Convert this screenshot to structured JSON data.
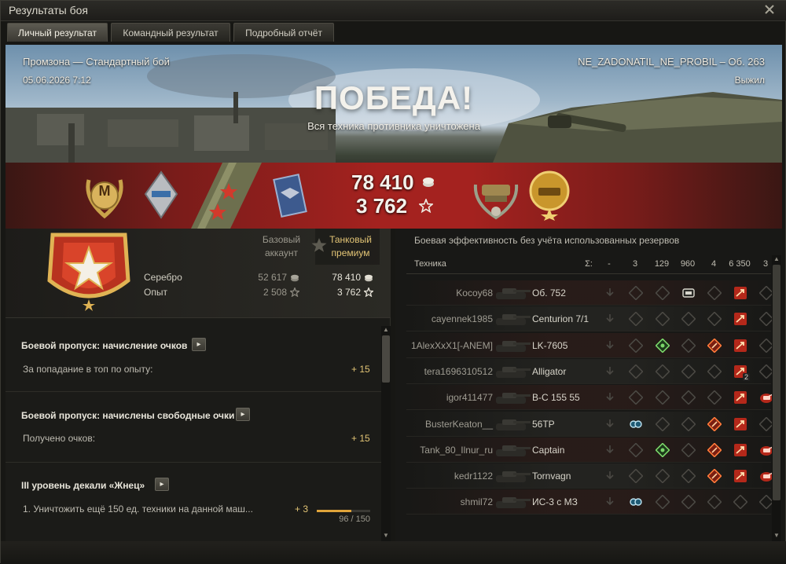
{
  "window": {
    "title": "Результаты боя"
  },
  "tabs": [
    {
      "label": "Личный результат",
      "active": true
    },
    {
      "label": "Командный результат",
      "active": false
    },
    {
      "label": "Подробный отчёт",
      "active": false
    }
  ],
  "battle": {
    "map_mode": "Промзона — Стандартный бой",
    "datetime": "05.06.2026 7:12",
    "player_vehicle": "NE_ZADONATIL_NE_PROBIL – Об. 263",
    "status": "Выжил",
    "result": "ПОБЕДА!",
    "result_sub": "Вся техника противника уничтожена",
    "credits": "78 410",
    "experience": "3 762"
  },
  "badges": {
    "mastery": "М"
  },
  "account": {
    "headers": {
      "base": "Базовый аккаунт",
      "premium": "Танковый премиум"
    },
    "rows": [
      {
        "label": "Серебро",
        "base": "52 617",
        "premium": "78 410",
        "icon": "credits-icon"
      },
      {
        "label": "Опыт",
        "base": "2 508",
        "premium": "3 762",
        "icon": "star-icon"
      }
    ]
  },
  "sections": [
    {
      "title": "Боевой пропуск: начисление очков",
      "row_label": "За попадание в топ по опыту:",
      "row_value": "+ 15"
    },
    {
      "title": "Боевой пропуск: начислены свободные очки",
      "row_label": "Получено очков:",
      "row_value": "+ 15"
    },
    {
      "title": "III уровень декали «Жнец»",
      "row_label": "1. Уничтожить ещё 150 ед. техники на данной маш...",
      "row_value": "+ 3",
      "progress_text": "96 / 150",
      "progress": 0.64
    }
  ],
  "efficiency": {
    "title": "Боевая эффективность без учёта использованных резервов",
    "header": {
      "vehicle": "Техника",
      "sum": "Σ:",
      "cols": [
        "-",
        "3",
        "129",
        "960",
        "4",
        "6 350",
        "3"
      ]
    },
    "rows": [
      {
        "player": "Kocoy68",
        "tank": "Об. 752",
        "icons": [
          "none",
          "dim",
          "dim",
          "spot",
          "dim",
          "dmg",
          "dim"
        ]
      },
      {
        "player": "cayennek1985",
        "tank": "Centurion 7/1",
        "icons": [
          "none",
          "dim",
          "dim",
          "dim",
          "dim",
          "dmg",
          "dim"
        ]
      },
      {
        "player": "1AlexXxX1[-ANEM]",
        "tank": "LK-7605",
        "icons": [
          "none",
          "dim",
          "crit",
          "dim",
          "kill",
          "dmg",
          "dim"
        ]
      },
      {
        "player": "tera1696310512",
        "tank": "Alligator",
        "icons": [
          "none",
          "dim",
          "dim",
          "dim",
          "dim",
          "dmg2",
          "dim"
        ],
        "badge": "2"
      },
      {
        "player": "igor411477",
        "tank": "В-С 155 55",
        "icons": [
          "none",
          "dim",
          "dim",
          "dim",
          "dim",
          "dmg",
          "tank"
        ]
      },
      {
        "player": "BusterKeaton__",
        "tank": "56TP",
        "icons": [
          "none",
          "assist",
          "dim",
          "dim",
          "kill",
          "dmg",
          "dim"
        ]
      },
      {
        "player": "Tank_80_Ilnur_ru",
        "tank": "Captain",
        "icons": [
          "none",
          "dim",
          "crit",
          "dim",
          "kill",
          "dmg",
          "tank"
        ]
      },
      {
        "player": "kedr1122",
        "tank": "Tornvagn",
        "icons": [
          "none",
          "dim",
          "dim",
          "dim",
          "kill",
          "dmg",
          "tank"
        ]
      },
      {
        "player": "shmil72",
        "tank": "ИС-3 с МЗ",
        "icons": [
          "none",
          "assist",
          "dim",
          "dim",
          "dim",
          "dim",
          "dim"
        ]
      }
    ]
  },
  "colors": {
    "accent_gold": "#e2c475",
    "victory_red": "#a4221f",
    "text": "#c8c6bd"
  }
}
